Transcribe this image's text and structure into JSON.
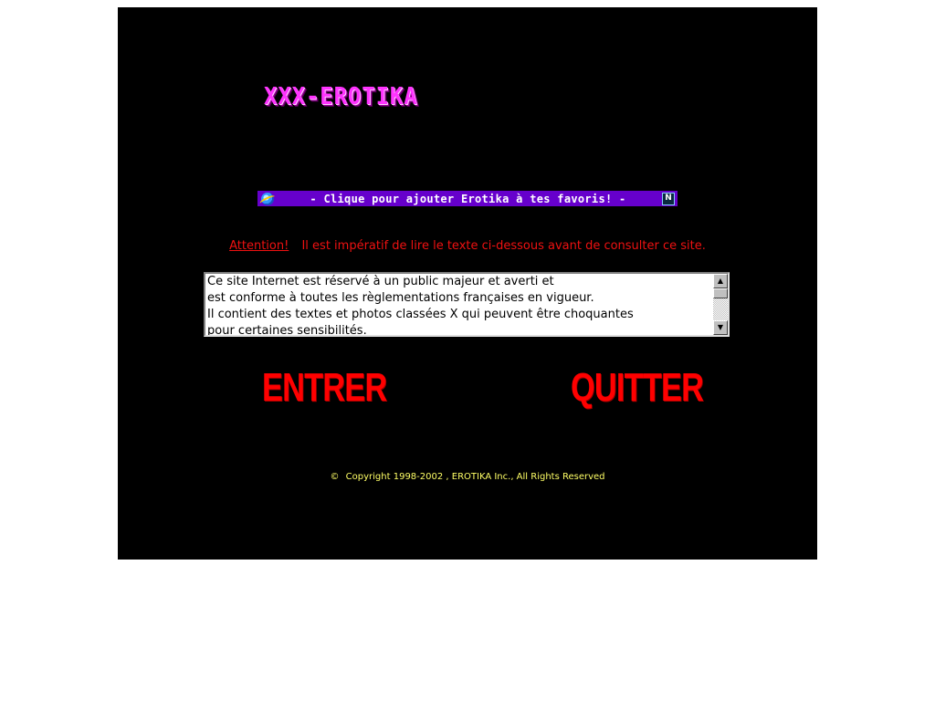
{
  "header": {
    "logo_text": "XXX-EROTIKA"
  },
  "favorites_bar": {
    "ie_icon": "internet-explorer-icon",
    "label": "- Clique pour ajouter Erotika à tes favoris! -",
    "ns_icon": "netscape-icon",
    "ns_letter": "N",
    "background": "#6600cc"
  },
  "warning": {
    "attention_label": "Attention!",
    "message": "Il est impératif de lire le texte ci-dessous avant de consulter ce site.",
    "color": "#ee1111"
  },
  "disclaimer": {
    "text": "Ce site Internet est réservé à un public majeur et averti et\nest conforme à toutes les règlementations françaises en vigueur.\nIl contient des textes et photos classées X qui peuvent être choquantes\npour certaines sensibilités."
  },
  "actions": {
    "enter_label": "ENTRER",
    "quit_label": "QUITTER",
    "color": "#ff0000"
  },
  "footer": {
    "copyright_symbol": "©",
    "copyright_text": "Copyright 1998-2002 , EROTIKA Inc., All Rights Reserved",
    "color": "#ffff66"
  }
}
